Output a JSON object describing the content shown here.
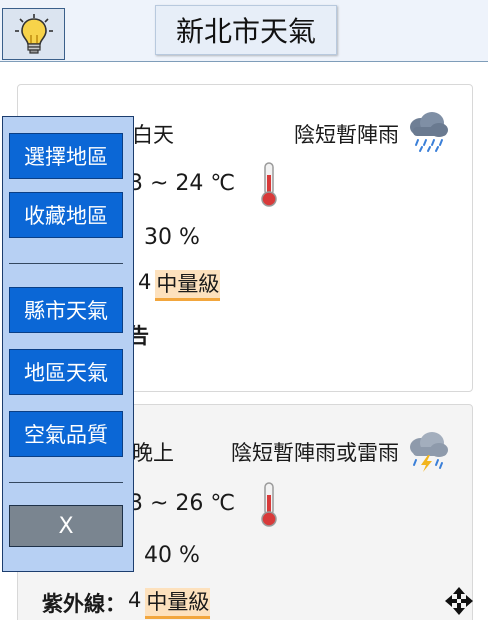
{
  "header": {
    "title": "新北市天氣",
    "bulb_icon": "lightbulb-icon"
  },
  "day_card": {
    "period": "白天",
    "condition": "陰短暫陣雨",
    "weather_icon": "rain-cloud-icon",
    "temperature": "3 ~ 24 ℃",
    "thermometer_icon": "thermometer-icon",
    "rain_chance": "30 %",
    "uv_number": "4",
    "uv_level": "中量級",
    "warning": "告"
  },
  "night_card": {
    "period": "晚上",
    "condition": "陰短暫陣雨或雷雨",
    "weather_icon": "thunderstorm-cloud-icon",
    "temperature": "3 ~ 26 ℃",
    "thermometer_icon": "thermometer-icon",
    "rain_chance": "40 %",
    "uv_label": "紫外線：",
    "uv_number": "4",
    "uv_level": "中量級"
  },
  "menu": {
    "items": [
      {
        "label": "選擇地區"
      },
      {
        "label": "收藏地區"
      },
      {
        "label": "縣市天氣"
      },
      {
        "label": "地區天氣"
      },
      {
        "label": "空氣品質"
      }
    ],
    "close_label": "X"
  },
  "colors": {
    "menu_button": "#0b67d6",
    "menu_panel": "#b7d0f3",
    "uv_badge": "#fde1bd",
    "uv_underline": "#f2a63d"
  },
  "move_icon": "move-arrows-icon"
}
